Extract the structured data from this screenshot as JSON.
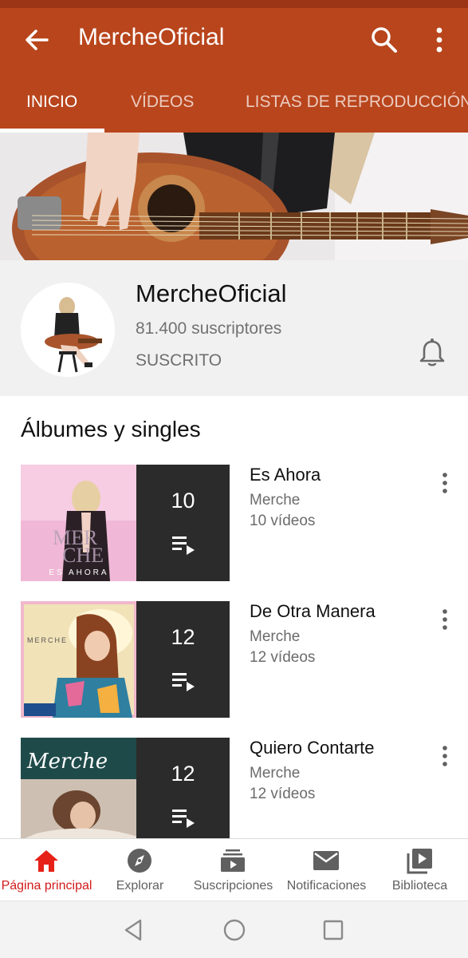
{
  "header": {
    "title": "MercheOficial"
  },
  "tabs": [
    {
      "label": "INICIO",
      "active": true
    },
    {
      "label": "VÍDEOS",
      "active": false
    },
    {
      "label": "LISTAS DE REPRODUCCIÓN",
      "active": false
    }
  ],
  "channel": {
    "name": "MercheOficial",
    "subscribers": "81.400 suscriptores",
    "status": "SUSCRITO"
  },
  "section": {
    "title": "Álbumes y singles"
  },
  "albums": [
    {
      "title": "Es Ahora",
      "artist": "Merche",
      "video_count_label": "10",
      "videos": "10 vídeos",
      "cover_text": "ES AHORA"
    },
    {
      "title": "De Otra Manera",
      "artist": "Merche",
      "video_count_label": "12",
      "videos": "12 vídeos",
      "cover_text": "MERCHE"
    },
    {
      "title": "Quiero Contarte",
      "artist": "Merche",
      "video_count_label": "12",
      "videos": "12 vídeos",
      "cover_text": "Merche"
    }
  ],
  "bottom_nav": [
    {
      "label": "Página principal",
      "icon": "home-icon",
      "active": true
    },
    {
      "label": "Explorar",
      "icon": "compass-icon",
      "active": false
    },
    {
      "label": "Suscripciones",
      "icon": "subscriptions-icon",
      "active": false
    },
    {
      "label": "Notificaciones",
      "icon": "mail-icon",
      "active": false
    },
    {
      "label": "Biblioteca",
      "icon": "library-icon",
      "active": false
    }
  ],
  "colors": {
    "app_bar": "#b9451c",
    "status_bar": "#9c3515",
    "active_nav": "#d21a1a",
    "count_box": "#2b2b2b"
  }
}
